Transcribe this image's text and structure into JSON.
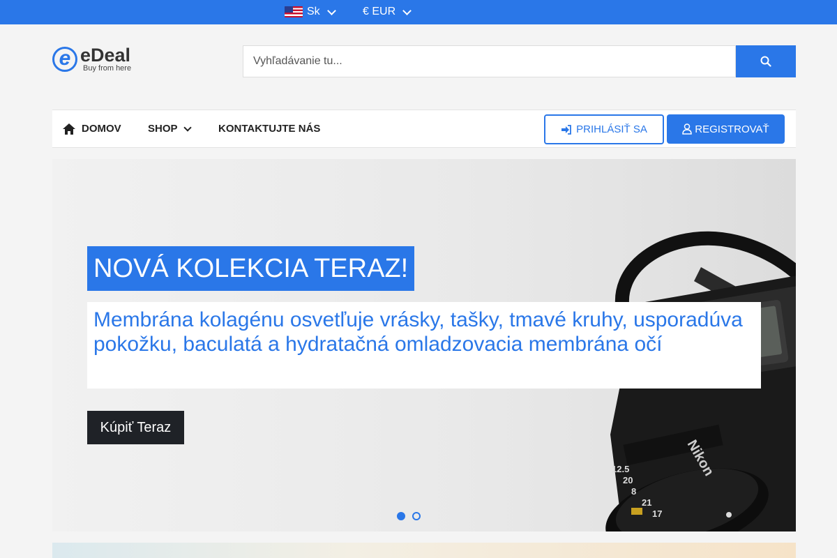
{
  "topbar": {
    "language": "Sk",
    "currency": "€ EUR",
    "bg_color": "#2a77e8"
  },
  "header": {
    "logo_name": "eDeal",
    "logo_tagline": "Buy from here",
    "search_placeholder": "Vyhľadávanie tu..."
  },
  "nav": {
    "home": "DOMOV",
    "shop": "SHOP",
    "contact": "KONTAKTUJTE NÁS",
    "login": "PRIHLÁSIŤ SA",
    "register": "REGISTROVAŤ"
  },
  "hero": {
    "title": "NOVÁ KOLEKCIA TERAZ!",
    "subtitle": "Membrána kolagénu osvetľuje vrásky, tašky, tmavé kruhy, usporadúva pokožku, baculatá a hydratačná omladzovacia membrána očí",
    "button": "Kúpiť Teraz",
    "slide_count": 2,
    "active_slide": 1,
    "image_subject": "camera",
    "lens_markings": [
      "17",
      "21",
      "8",
      "20",
      "12.5"
    ],
    "camera_brand": "Nikon"
  },
  "colors": {
    "accent": "#2a77e8",
    "dark_button": "#1f2227"
  }
}
